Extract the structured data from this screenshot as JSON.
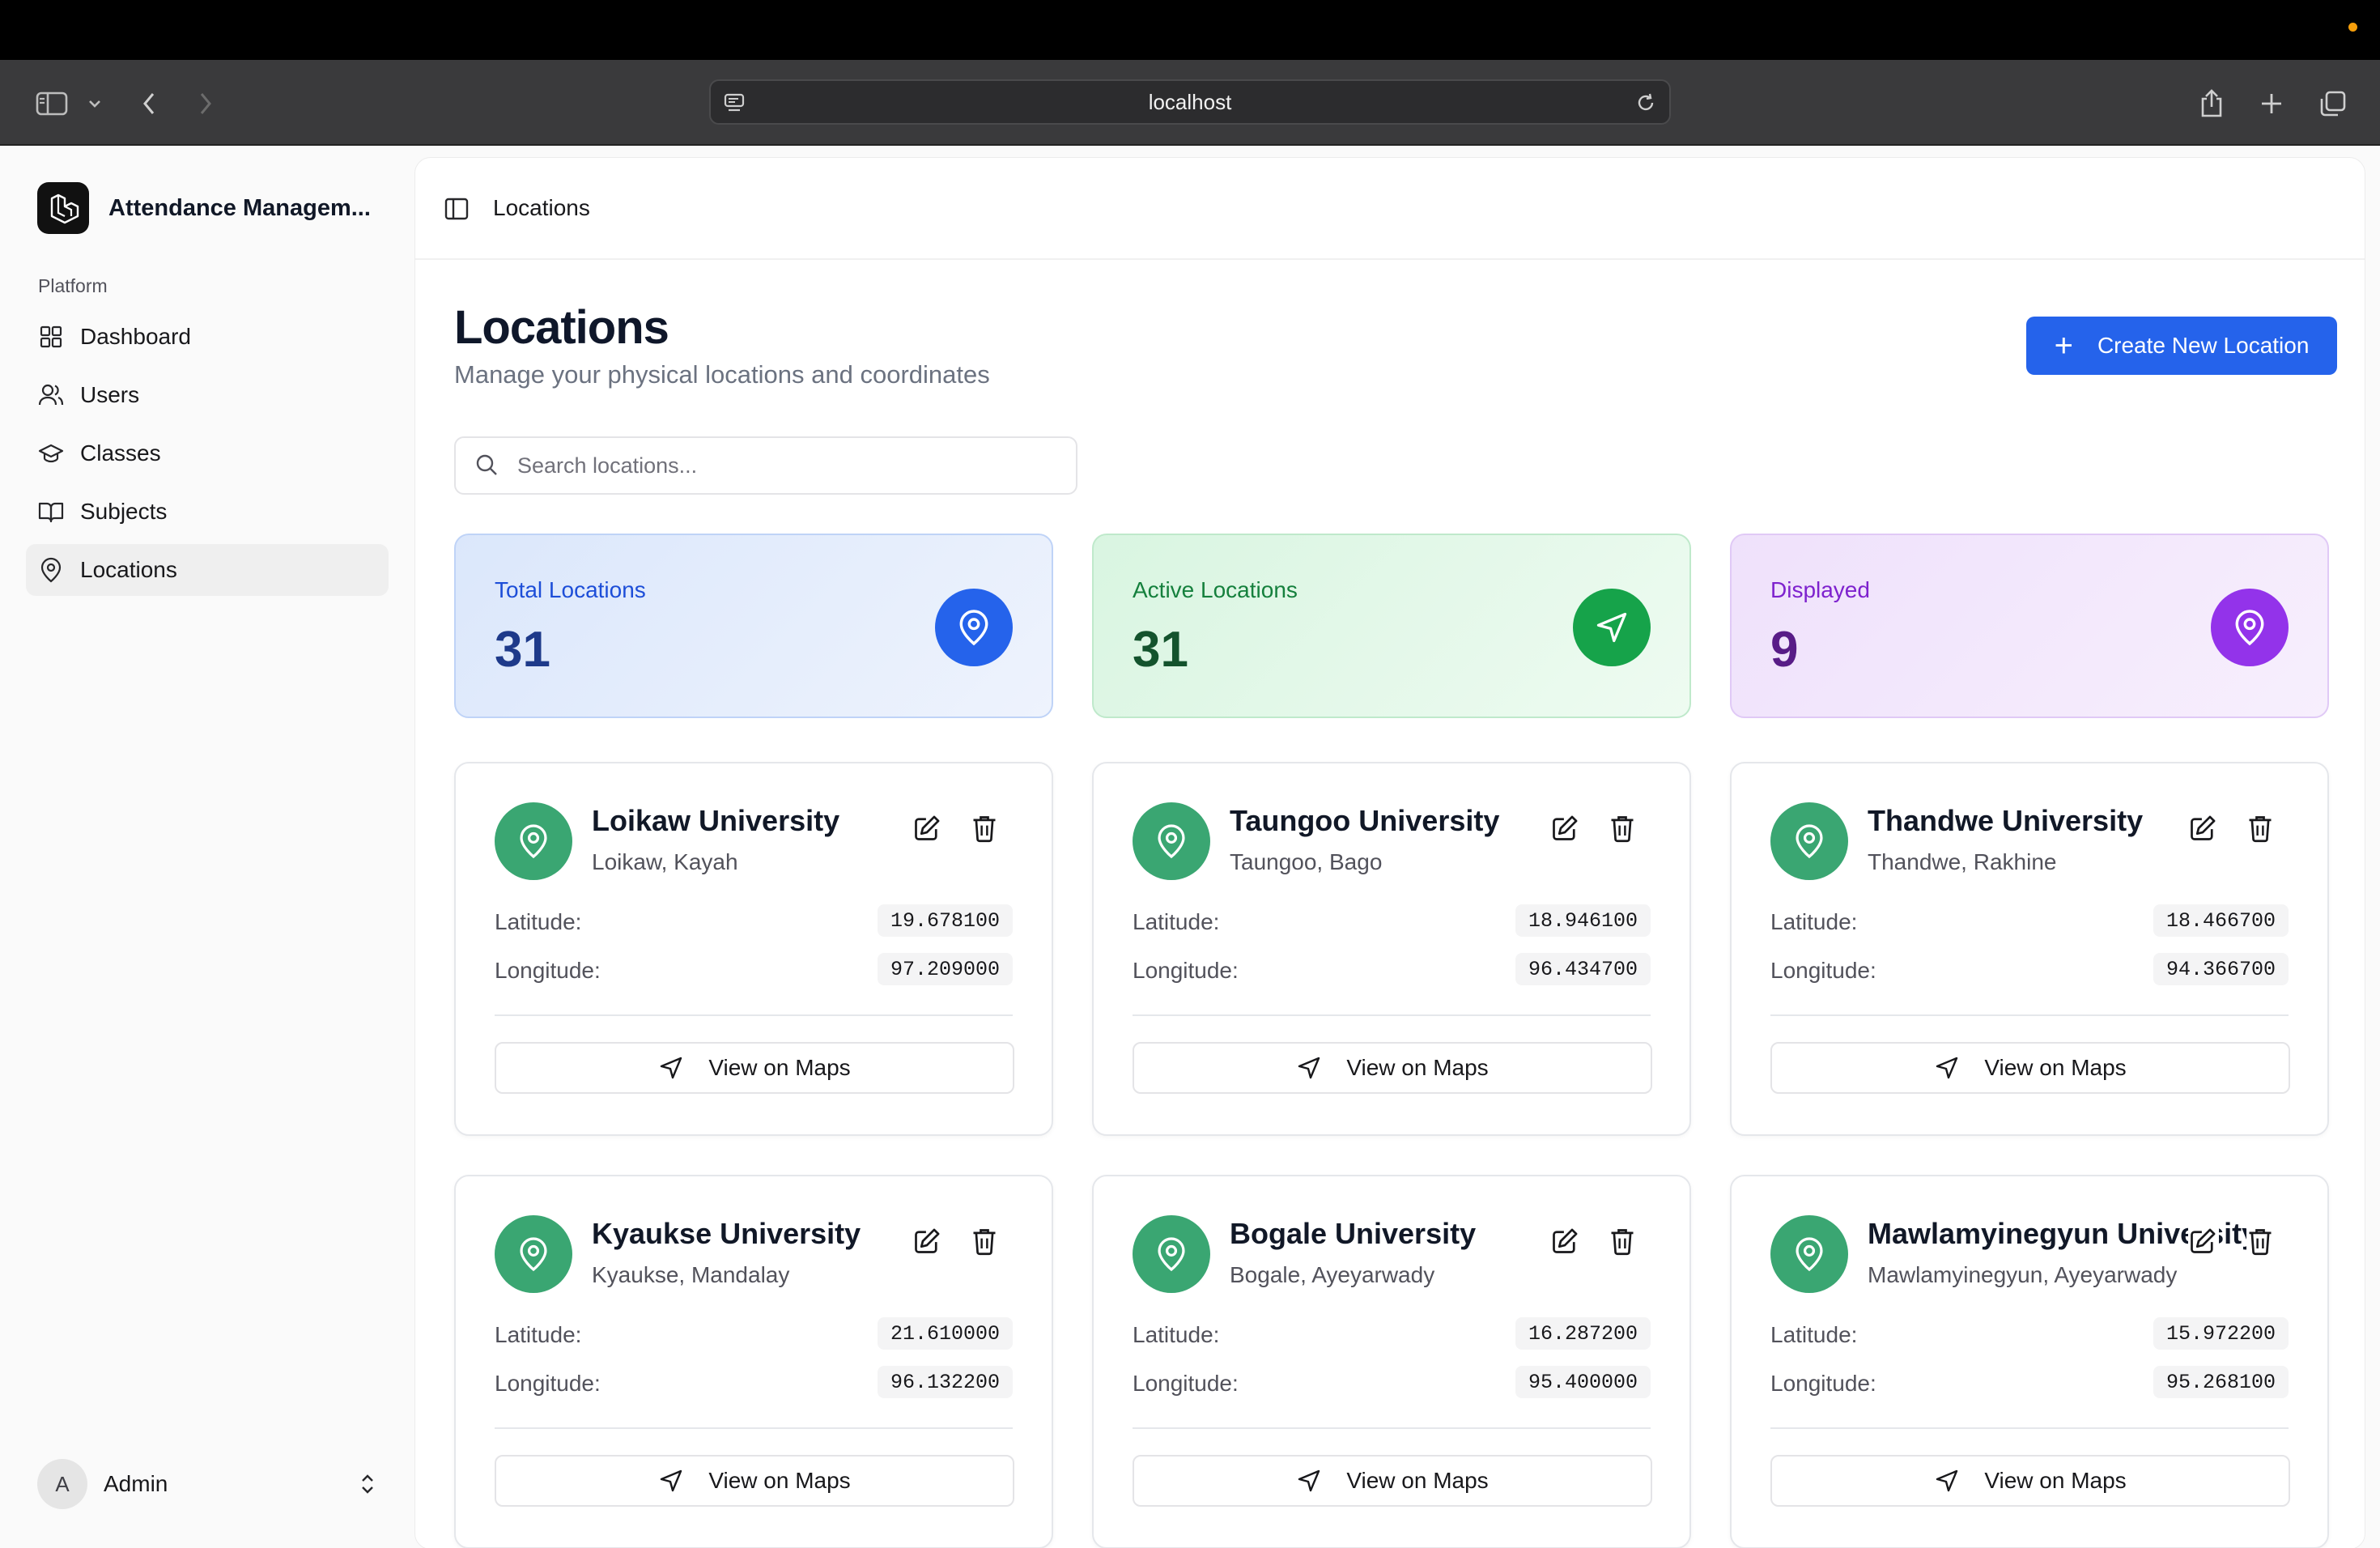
{
  "browser": {
    "url": "localhost"
  },
  "sidebar": {
    "app_name": "Attendance Managem...",
    "section_label": "Platform",
    "items": [
      {
        "label": "Dashboard",
        "icon": "grid-icon"
      },
      {
        "label": "Users",
        "icon": "users-icon"
      },
      {
        "label": "Classes",
        "icon": "graduation-cap-icon"
      },
      {
        "label": "Subjects",
        "icon": "book-icon"
      },
      {
        "label": "Locations",
        "icon": "map-pin-icon",
        "active": true
      }
    ],
    "user": {
      "initial": "A",
      "name": "Admin"
    }
  },
  "header": {
    "breadcrumb": "Locations"
  },
  "main": {
    "title": "Locations",
    "subtitle": "Manage your physical locations and coordinates",
    "create_button": "Create New Location",
    "search_placeholder": "Search locations...",
    "stats": [
      {
        "label": "Total Locations",
        "value": "31",
        "color": "#2563eb"
      },
      {
        "label": "Active Locations",
        "value": "31",
        "color": "#16a34a"
      },
      {
        "label": "Displayed",
        "value": "9",
        "color": "#9333ea"
      }
    ],
    "latitude_label": "Latitude:",
    "longitude_label": "Longitude:",
    "maps_button": "View on Maps",
    "locations": [
      {
        "name": "Loikaw University",
        "city": "Loikaw, Kayah",
        "lat": "19.678100",
        "lon": "97.209000"
      },
      {
        "name": "Taungoo University",
        "city": "Taungoo, Bago",
        "lat": "18.946100",
        "lon": "96.434700"
      },
      {
        "name": "Thandwe University",
        "city": "Thandwe, Rakhine",
        "lat": "18.466700",
        "lon": "94.366700"
      },
      {
        "name": "Kyaukse University",
        "city": "Kyaukse, Mandalay",
        "lat": "21.610000",
        "lon": "96.132200"
      },
      {
        "name": "Bogale University",
        "city": "Bogale, Ayeyarwady",
        "lat": "16.287200",
        "lon": "95.400000"
      },
      {
        "name": "Mawlamyinegyun University",
        "city": "Mawlamyinegyun, Ayeyarwady",
        "lat": "15.972200",
        "lon": "95.268100"
      }
    ]
  }
}
